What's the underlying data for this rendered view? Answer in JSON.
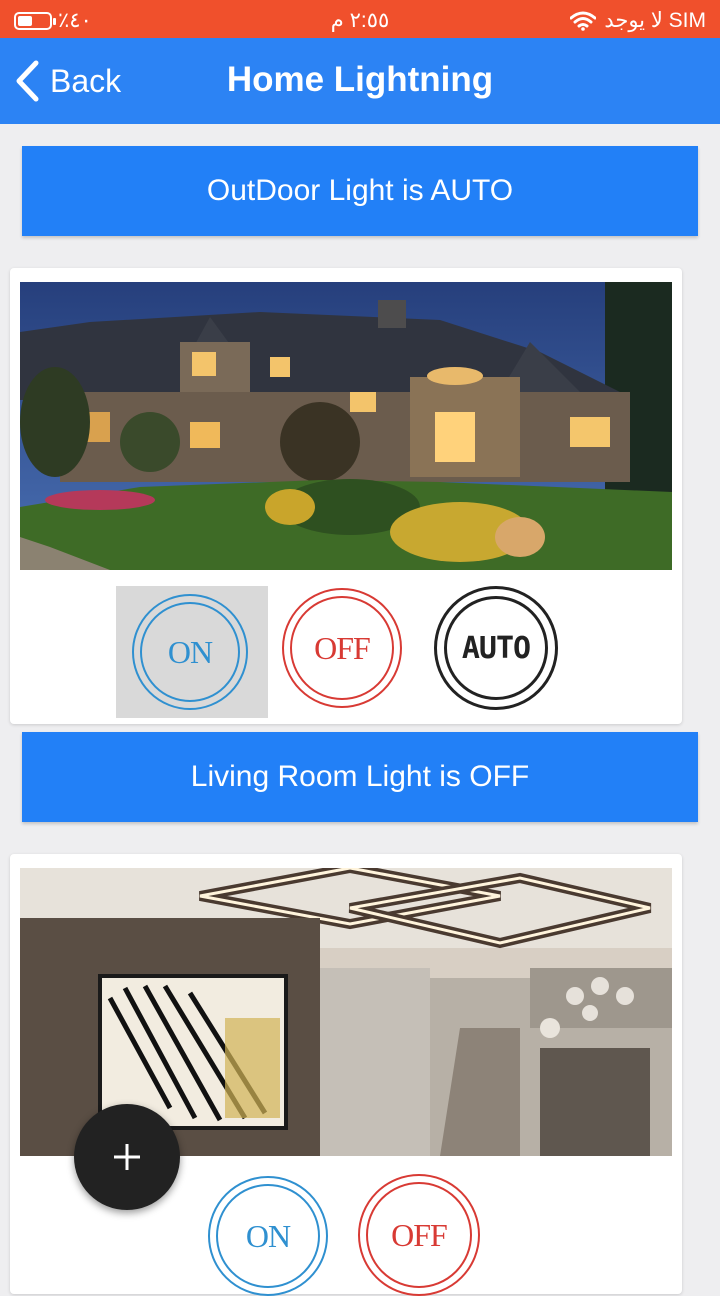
{
  "status_bar": {
    "battery": "٪٤٠",
    "battery_level": 0.4,
    "time": "٢:٥٥ م",
    "carrier": "لا يوجد SIM"
  },
  "nav": {
    "back_label": "Back",
    "title": "Home Lightning"
  },
  "sections": [
    {
      "banner": "OutDoor Light is AUTO",
      "scene_icon": "house-exterior-night-photo",
      "buttons": {
        "on": "ON",
        "off": "OFF",
        "auto": "AUTO"
      },
      "selected": "ON"
    },
    {
      "banner": "Living Room Light is OFF",
      "scene_icon": "living-room-interior-photo",
      "buttons": {
        "on": "ON",
        "off": "OFF"
      }
    }
  ],
  "fab": {
    "label": "+"
  },
  "colors": {
    "status_bar": "#f0502c",
    "nav_bar": "#2c83f4",
    "banner": "#2280f7",
    "on": "#2f90d0",
    "off": "#d83a34",
    "auto": "#222222"
  }
}
